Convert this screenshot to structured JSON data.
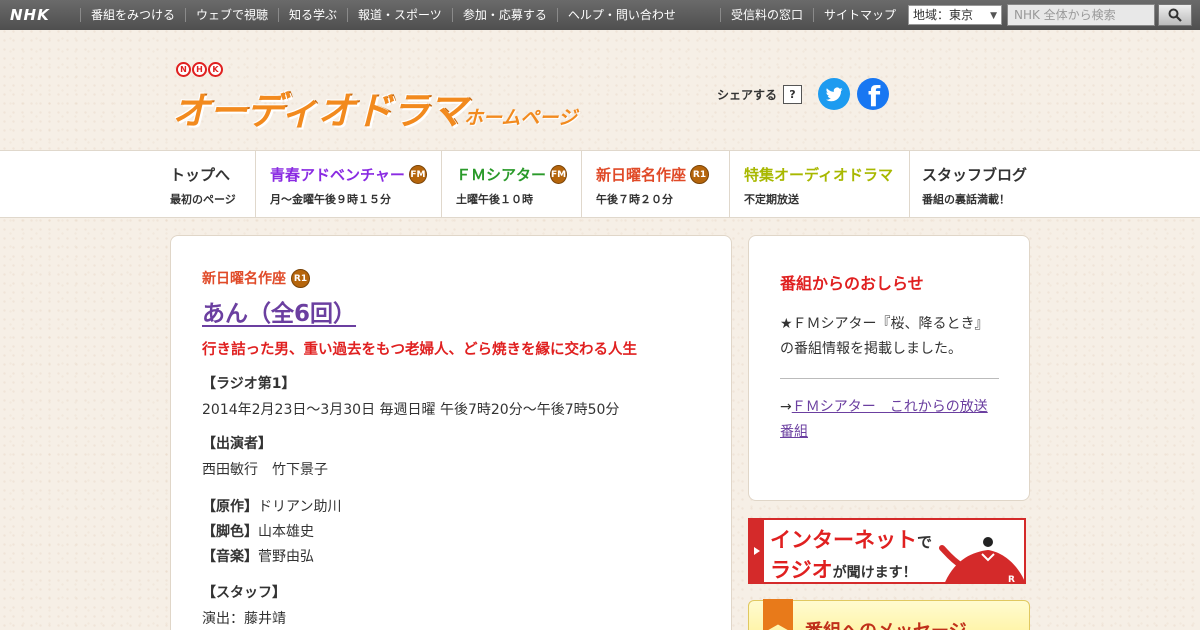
{
  "global_bar": {
    "logo": "NHK",
    "nav": [
      "番組をみつける",
      "ウェブで視聴",
      "知る学ぶ",
      "報道・スポーツ",
      "参加・応募する",
      "ヘルプ・問い合わせ"
    ],
    "right_nav": [
      "受信料の窓口",
      "サイトマップ"
    ],
    "region_label": "地域：",
    "region_value": "東京",
    "search_placeholder": "NHK 全体から検索"
  },
  "header": {
    "nhk_badge": [
      "N",
      "H",
      "K"
    ],
    "title": "オーディオドラマ",
    "subtitle": "ホームページ",
    "share_label": "シェアする",
    "share_help": "?"
  },
  "program_nav": [
    {
      "title": "トップへ",
      "sub": "最初のページ",
      "color": "#333333",
      "badge": ""
    },
    {
      "title": "青春アドベンチャー",
      "sub": "月～金曜午後９時１５分",
      "color": "#8a2be2",
      "badge": "FM"
    },
    {
      "title": "ＦＭシアター",
      "sub": "土曜午後１０時",
      "color": "#2a9a2a",
      "badge": "FM"
    },
    {
      "title": "新日曜名作座",
      "sub": "午後７時２０分",
      "color": "#e04a28",
      "badge": "R1"
    },
    {
      "title": "特集オーディオドラマ",
      "sub": "不定期放送",
      "color": "#a8b800",
      "badge": ""
    },
    {
      "title": "スタッフブログ",
      "sub": "番組の裏話満載！",
      "color": "#333333",
      "badge": ""
    }
  ],
  "main": {
    "category": "新日曜名作座",
    "category_badge": "R1",
    "title": "あん（全6回）",
    "catchphrase": "行き詰った男、重い過去をもつ老婦人、どら焼きを縁に交わる人生",
    "broadcast_heading": "【ラジオ第1】",
    "broadcast_schedule": "2014年2月23日～3月30日 毎週日曜 午後7時20分～午後7時50分",
    "cast_heading": "【出演者】",
    "cast": "西田敏行　竹下景子",
    "credits": [
      {
        "label": "【原作】",
        "value": "ドリアン助川"
      },
      {
        "label": "【脚色】",
        "value": "山本雄史"
      },
      {
        "label": "【音楽】",
        "value": "菅野由弘"
      }
    ],
    "staff_heading": "【スタッフ】",
    "staff": "演出：藤井靖"
  },
  "news": {
    "title": "番組からのおしらせ",
    "body": "★ＦＭシアター『桜、降るとき』の番組情報を掲載しました。",
    "link_prefix": "→",
    "link_text": "ＦＭシアター　これからの放送番組"
  },
  "radiko_banner": {
    "line1": "インターネット",
    "line1_suffix": "で",
    "line2": "ラジオ",
    "line2_suffix": "が聞けます！"
  },
  "message_banner": {
    "text": "番組へのメッセージ"
  },
  "colors": {
    "accent_orange": "#f28a1e",
    "link_purple": "#6b3fa0",
    "red": "#e02020"
  }
}
